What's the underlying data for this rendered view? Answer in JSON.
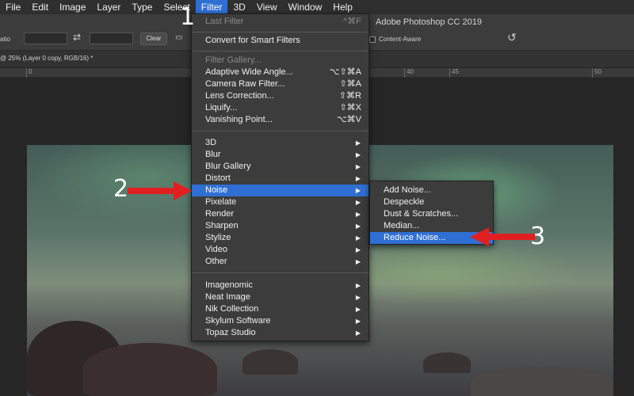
{
  "menubar": {
    "items": [
      "File",
      "Edit",
      "Image",
      "Layer",
      "Type",
      "Select",
      "Filter",
      "3D",
      "View",
      "Window",
      "Help"
    ],
    "active_index": 6
  },
  "options_bar": {
    "ratio_label": "atio",
    "clear_label": "Clear",
    "content_aware_label": "Content-Aware"
  },
  "app_title": "Adobe Photoshop CC 2019",
  "document_tab": "@ 25% (Layer 0 copy, RGB/16) *",
  "ruler_ticks": [
    "0",
    "40",
    "45",
    "50"
  ],
  "filter_menu": {
    "last_filter": {
      "label": "Last Filter",
      "shortcut": "^⌘F"
    },
    "convert_smart": "Convert for Smart Filters",
    "group_filters": [
      {
        "label": "Filter Gallery...",
        "shortcut": ""
      },
      {
        "label": "Adaptive Wide Angle...",
        "shortcut": "⌥⇧⌘A"
      },
      {
        "label": "Camera Raw Filter...",
        "shortcut": "⇧⌘A"
      },
      {
        "label": "Lens Correction...",
        "shortcut": "⇧⌘R"
      },
      {
        "label": "Liquify...",
        "shortcut": "⇧⌘X"
      },
      {
        "label": "Vanishing Point...",
        "shortcut": "⌥⌘V"
      }
    ],
    "categories": [
      "3D",
      "Blur",
      "Blur Gallery",
      "Distort",
      "Noise",
      "Pixelate",
      "Render",
      "Sharpen",
      "Stylize",
      "Video",
      "Other"
    ],
    "plugins": [
      "Imagenomic",
      "Neat Image",
      "Nik Collection",
      "Skylum Software",
      "Topaz Studio"
    ],
    "highlighted": "Noise"
  },
  "noise_submenu": {
    "items": [
      "Add Noise...",
      "Despeckle",
      "Dust & Scratches...",
      "Median...",
      "Reduce Noise..."
    ],
    "highlighted": "Reduce Noise..."
  },
  "annotations": {
    "step1": "1",
    "step2": "2",
    "step3": "3",
    "arrow_color": "#e02020"
  },
  "colors": {
    "menu_highlight": "#2f6fd4",
    "menu_bg": "#3c3c3c"
  }
}
